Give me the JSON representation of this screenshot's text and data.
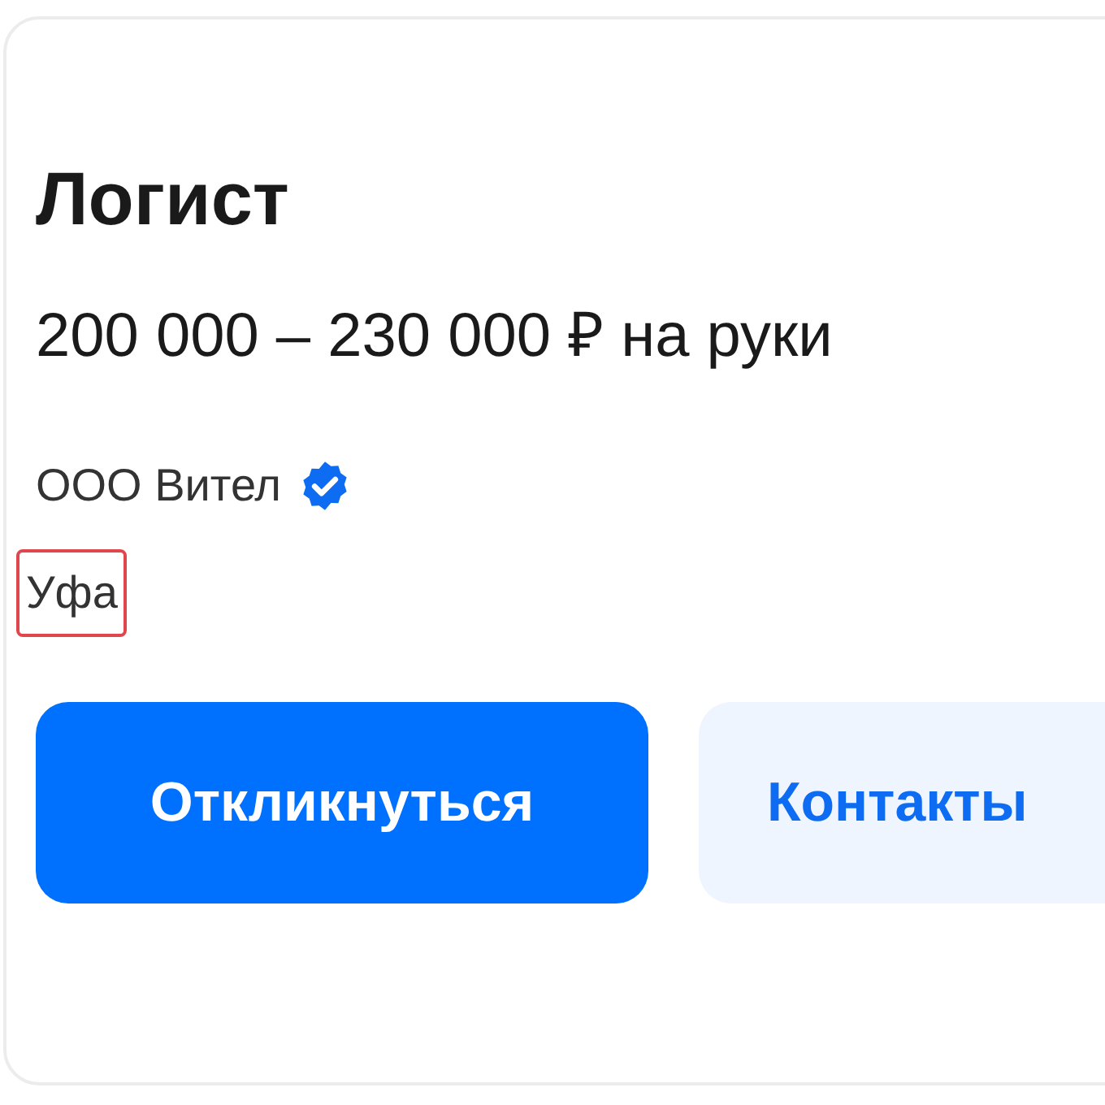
{
  "vacancy": {
    "title": "Логист",
    "salary": "200 000 – 230 000 ₽ на руки",
    "company": {
      "name": "ООО Вител",
      "verified": true
    },
    "city": {
      "name": "Уфа",
      "highlighted": true
    }
  },
  "buttons": [
    {
      "label": "Откликнуться",
      "kind": "primary"
    },
    {
      "label": "Контакты",
      "kind": "secondary"
    }
  ]
}
